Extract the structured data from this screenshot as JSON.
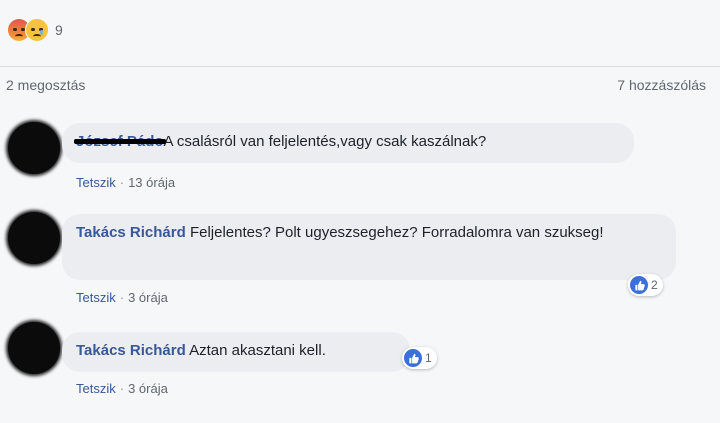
{
  "post": {
    "reaction_count": "9",
    "shares_label": "2 megosztás",
    "comments_label": "7 hozzászólás"
  },
  "comments": [
    {
      "author": "József Pádo",
      "text": "A csalásról van feljelentés,vagy csak kaszálnak?",
      "like_label": "Tetszik",
      "time": "13 órája"
    },
    {
      "author": "Takács Richárd",
      "text": "Feljelentes? Polt ugyeszsegehez? Forradalomra van szukseg!",
      "like_label": "Tetszik",
      "time": "3 órája",
      "likes": "2"
    },
    {
      "author": "Takács Richárd",
      "text": "Aztan akasztani kell.",
      "like_label": "Tetszik",
      "time": "3 órája",
      "likes": "1"
    }
  ],
  "colors": {
    "author": "#385898",
    "bubble": "#ebedf0",
    "like_blue": "#3b6fd9"
  },
  "icons": [
    "angry-reaction-icon",
    "sad-reaction-icon",
    "like-icon"
  ]
}
